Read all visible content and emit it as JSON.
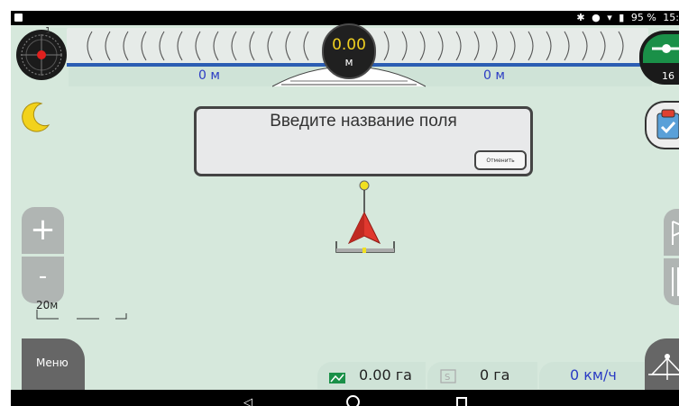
{
  "status_bar": {
    "battery": "95 %",
    "time": "15:"
  },
  "guidance": {
    "offset_value": "0.00",
    "offset_unit": "м",
    "left_distance": "0 м",
    "right_distance": "0 м",
    "compass_number": "1"
  },
  "gps": {
    "satellites": "16"
  },
  "field_dialog": {
    "title": "Введите название поля",
    "cancel_label": "Отменить"
  },
  "zoom": {
    "in_label": "+",
    "out_label": "-"
  },
  "scale": {
    "label": "20м"
  },
  "menu": {
    "label": "Меню"
  },
  "stats": {
    "area": "0.00 га",
    "s_area": "0 га",
    "speed": "0 км/ч"
  },
  "colors": {
    "background": "#d6e8dc",
    "accent_blue": "#2b3cc4",
    "gauge_text": "#f0d020",
    "gps_green": "#1a9048",
    "vehicle_red": "#e0382e"
  }
}
